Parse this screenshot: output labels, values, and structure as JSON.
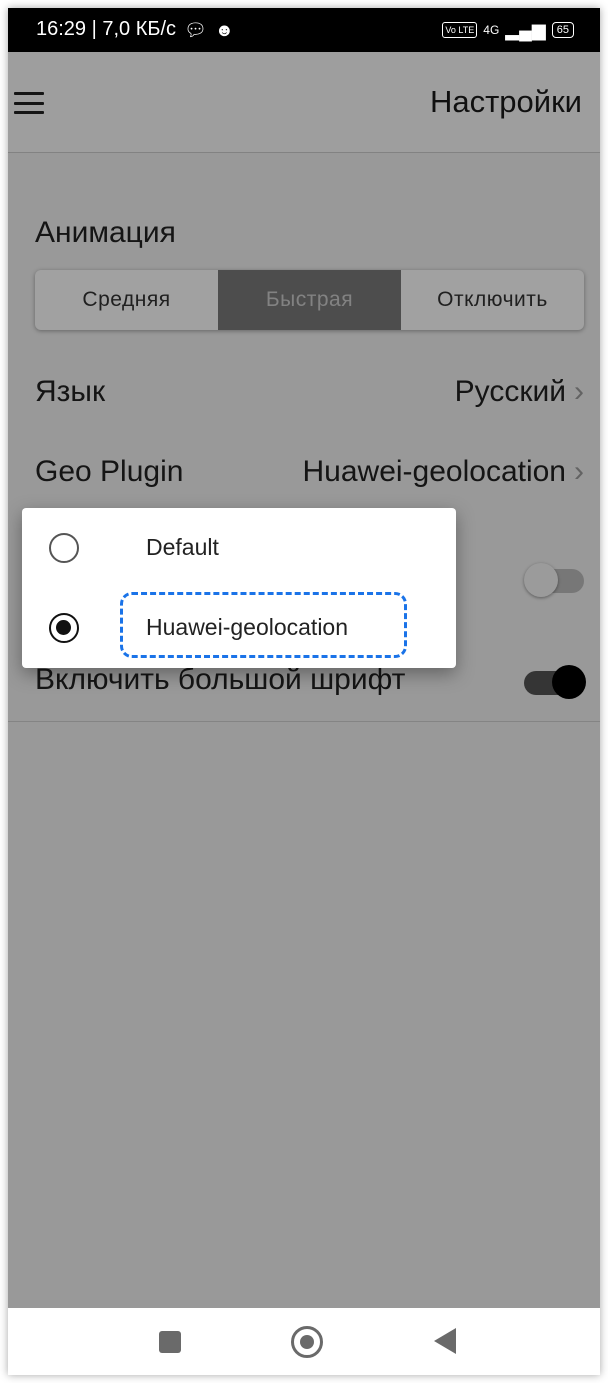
{
  "status_bar": {
    "time_speed": "16:29 | 7,0 КБ/с",
    "network": "4G",
    "battery": "65",
    "volte": "Vo LTE"
  },
  "app_bar": {
    "title": "Настройки"
  },
  "settings": {
    "animation": {
      "label": "Анимация",
      "options": [
        "Средняя",
        "Быстрая",
        "Отключить"
      ],
      "selected": "Быстрая"
    },
    "language": {
      "label": "Язык",
      "value": "Русский"
    },
    "geo_plugin": {
      "label": "Geo Plugin",
      "value": "Huawei-geolocation"
    },
    "large_font": {
      "label": "Включить большой шрифт",
      "enabled": true
    },
    "hidden_toggle": {
      "enabled": false
    }
  },
  "geo_dialog": {
    "options": [
      {
        "label": "Default",
        "selected": false
      },
      {
        "label": "Huawei-geolocation",
        "selected": true
      }
    ],
    "highlight_color": "#1a73e8"
  },
  "colors": {
    "segment_active": "#7a7a7a",
    "scrim": "rgba(0,0,0,0.37)"
  }
}
